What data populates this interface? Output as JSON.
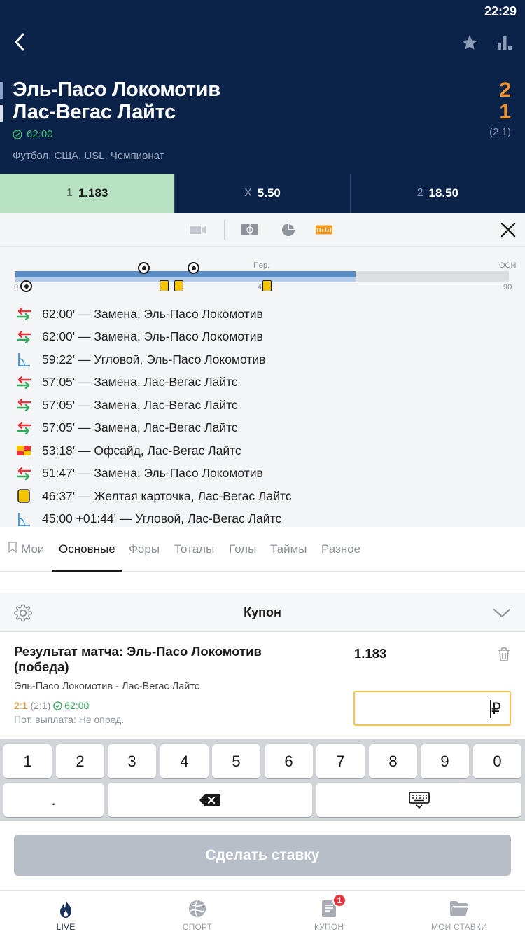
{
  "status_bar": {
    "time": "22:29"
  },
  "match": {
    "team1": "Эль-Пасо Локомотив",
    "team2": "Лас-Вегас Лайтс",
    "score1": "2",
    "score2": "1",
    "halftime": "(2:1)",
    "time": "62:00",
    "league": "Футбол. США. USL. Чемпионат"
  },
  "odds": [
    {
      "label": "1",
      "value": "1.183",
      "selected": true
    },
    {
      "label": "X",
      "value": "5.50",
      "selected": false
    },
    {
      "label": "2",
      "value": "18.50",
      "selected": false
    }
  ],
  "toolbar_icons": [
    "video-camera-icon",
    "field-icon",
    "pie-chart-icon",
    "timeline-icon",
    "close-icon"
  ],
  "timeline": {
    "start_label": "0",
    "mid_label": "Пер.",
    "mid_value": "45",
    "end_top_label": "ОСН",
    "end_label": "90",
    "elapsed_fraction": 0.689
  },
  "events": [
    {
      "icon": "substitution-icon",
      "text": "62:00' — Замена, Эль-Пасо Локомотив"
    },
    {
      "icon": "substitution-icon",
      "text": "62:00' — Замена, Эль-Пасо Локомотив"
    },
    {
      "icon": "corner-icon",
      "text": "59:22' — Угловой, Эль-Пасо Локомотив"
    },
    {
      "icon": "substitution-icon",
      "text": "57:05' — Замена, Лас-Вегас Лайтс"
    },
    {
      "icon": "substitution-icon",
      "text": "57:05' — Замена, Лас-Вегас Лайтс"
    },
    {
      "icon": "substitution-icon",
      "text": "57:05' — Замена, Лас-Вегас Лайтс"
    },
    {
      "icon": "offside-flag-icon",
      "text": "53:18' — Офсайд, Лас-Вегас Лайтс"
    },
    {
      "icon": "substitution-icon",
      "text": "51:47' — Замена, Эль-Пасо Локомотив"
    },
    {
      "icon": "yellow-card-icon",
      "text": "46:37' — Желтая карточка, Лас-Вегас Лайтс"
    },
    {
      "icon": "corner-icon",
      "text": "45:00 +01:44' — Угловой, Лас-Вегас Лайтс"
    }
  ],
  "tabs": {
    "mine": "Мои",
    "main": "Основные",
    "handicaps": "Форы",
    "totals": "Тоталы",
    "goals": "Голы",
    "halves": "Таймы",
    "misc": "Разное"
  },
  "coupon": {
    "title": "Купон",
    "bet_title": "Результат матча: Эль-Пасо Локомотив (победа)",
    "bet_odd": "1.183",
    "bet_teams": "Эль-Пасо Локомотив - Лас-Вегас Лайтс",
    "bet_score": "2:1",
    "bet_halftime": "(2:1)",
    "bet_time": "62:00",
    "payout": "Пот. выплата: Не опред.",
    "stake_value": "",
    "currency": "₽"
  },
  "keypad": {
    "digits": [
      "1",
      "2",
      "3",
      "4",
      "5",
      "6",
      "7",
      "8",
      "9",
      "0"
    ],
    "dot": "."
  },
  "submit_label": "Сделать ставку",
  "bottom_nav": [
    {
      "label": "LIVE",
      "icon": "flame-icon",
      "active": true
    },
    {
      "label": "СПОРТ",
      "icon": "ball-icon",
      "active": false
    },
    {
      "label": "КУПОН",
      "icon": "coupon-icon",
      "active": false,
      "badge": "1"
    },
    {
      "label": "МОИ СТАВКИ",
      "icon": "folder-icon",
      "active": false
    }
  ],
  "colors": {
    "header_bg": "#0c2349",
    "score": "#f0932e",
    "selected_odd": "#b8e2c2",
    "stake_border": "#f5c24a",
    "badge": "#e8343c"
  }
}
